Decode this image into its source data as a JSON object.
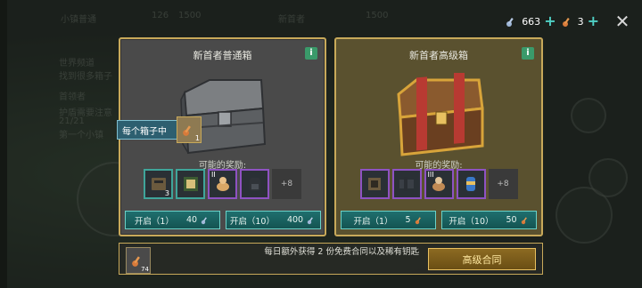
{
  "background": {
    "texts": [
      "小镇普通",
      "126",
      "1500",
      "新首者",
      "1500",
      "世界频道",
      "找到很多箱子",
      "首领者",
      "护盾需要注意",
      "21/21",
      "第一个小镇"
    ]
  },
  "topbar": {
    "currency1_value": "663",
    "currency2_value": "3",
    "plus_symbol": "+",
    "close_symbol": "✕"
  },
  "panels": {
    "normal": {
      "title": "新首者普通箱",
      "info": "i",
      "rewards_label": "可能的奖励:",
      "rewards": [
        {
          "icon": "weapon-parts-icon",
          "count": "3",
          "tier": ""
        },
        {
          "icon": "book-icon",
          "count": "",
          "tier": ""
        },
        {
          "icon": "dog-icon",
          "count": "",
          "tier": "II"
        },
        {
          "icon": "backpack-icon",
          "count": "",
          "tier": ""
        }
      ],
      "more": "+8",
      "buttons": [
        {
          "label": "开启（1）",
          "cost": "40"
        },
        {
          "label": "开启（10）",
          "cost": "400"
        }
      ]
    },
    "advanced": {
      "title": "新首者高级箱",
      "info": "i",
      "rewards_label": "可能的奖励:",
      "rewards": [
        {
          "icon": "weapon-parts-icon",
          "count": "",
          "tier": ""
        },
        {
          "icon": "rifle-parts-icon",
          "count": "",
          "tier": ""
        },
        {
          "icon": "dog-icon",
          "count": "",
          "tier": "III"
        },
        {
          "icon": "canister-icon",
          "count": "",
          "tier": ""
        }
      ],
      "more": "+8",
      "buttons": [
        {
          "label": "开启（1）",
          "cost": "5"
        },
        {
          "label": "开启（10）",
          "cost": "50"
        }
      ]
    }
  },
  "tooltip": {
    "text": "每个箱子中",
    "key_count": "1"
  },
  "bottom": {
    "key_count": "74",
    "text": "每日额外获得 2 份免费合同以及稀有钥匙",
    "button": "高级合同"
  },
  "colors": {
    "teal_accent": "#4fd1c5",
    "gold_border": "#c8a95a",
    "normal_panel": "#4a4a4a",
    "advanced_panel": "#5a512f"
  }
}
